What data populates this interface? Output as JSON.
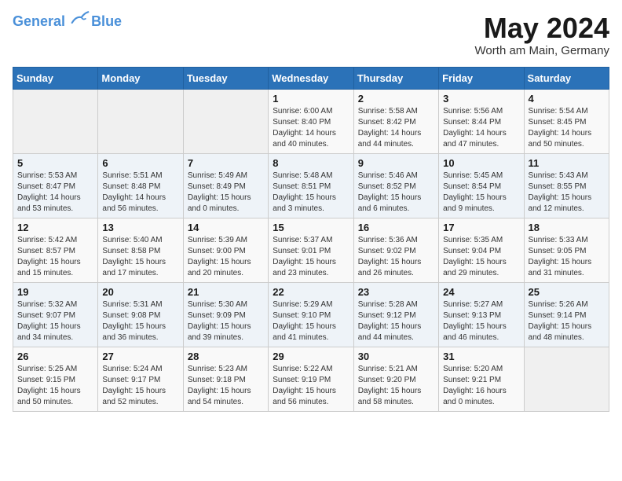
{
  "header": {
    "logo_line1": "General",
    "logo_line2": "Blue",
    "month": "May 2024",
    "location": "Worth am Main, Germany"
  },
  "weekdays": [
    "Sunday",
    "Monday",
    "Tuesday",
    "Wednesday",
    "Thursday",
    "Friday",
    "Saturday"
  ],
  "weeks": [
    [
      {
        "day": "",
        "sunrise": "",
        "sunset": "",
        "daylight": ""
      },
      {
        "day": "",
        "sunrise": "",
        "sunset": "",
        "daylight": ""
      },
      {
        "day": "",
        "sunrise": "",
        "sunset": "",
        "daylight": ""
      },
      {
        "day": "1",
        "sunrise": "Sunrise: 6:00 AM",
        "sunset": "Sunset: 8:40 PM",
        "daylight": "Daylight: 14 hours and 40 minutes."
      },
      {
        "day": "2",
        "sunrise": "Sunrise: 5:58 AM",
        "sunset": "Sunset: 8:42 PM",
        "daylight": "Daylight: 14 hours and 44 minutes."
      },
      {
        "day": "3",
        "sunrise": "Sunrise: 5:56 AM",
        "sunset": "Sunset: 8:44 PM",
        "daylight": "Daylight: 14 hours and 47 minutes."
      },
      {
        "day": "4",
        "sunrise": "Sunrise: 5:54 AM",
        "sunset": "Sunset: 8:45 PM",
        "daylight": "Daylight: 14 hours and 50 minutes."
      }
    ],
    [
      {
        "day": "5",
        "sunrise": "Sunrise: 5:53 AM",
        "sunset": "Sunset: 8:47 PM",
        "daylight": "Daylight: 14 hours and 53 minutes."
      },
      {
        "day": "6",
        "sunrise": "Sunrise: 5:51 AM",
        "sunset": "Sunset: 8:48 PM",
        "daylight": "Daylight: 14 hours and 56 minutes."
      },
      {
        "day": "7",
        "sunrise": "Sunrise: 5:49 AM",
        "sunset": "Sunset: 8:49 PM",
        "daylight": "Daylight: 15 hours and 0 minutes."
      },
      {
        "day": "8",
        "sunrise": "Sunrise: 5:48 AM",
        "sunset": "Sunset: 8:51 PM",
        "daylight": "Daylight: 15 hours and 3 minutes."
      },
      {
        "day": "9",
        "sunrise": "Sunrise: 5:46 AM",
        "sunset": "Sunset: 8:52 PM",
        "daylight": "Daylight: 15 hours and 6 minutes."
      },
      {
        "day": "10",
        "sunrise": "Sunrise: 5:45 AM",
        "sunset": "Sunset: 8:54 PM",
        "daylight": "Daylight: 15 hours and 9 minutes."
      },
      {
        "day": "11",
        "sunrise": "Sunrise: 5:43 AM",
        "sunset": "Sunset: 8:55 PM",
        "daylight": "Daylight: 15 hours and 12 minutes."
      }
    ],
    [
      {
        "day": "12",
        "sunrise": "Sunrise: 5:42 AM",
        "sunset": "Sunset: 8:57 PM",
        "daylight": "Daylight: 15 hours and 15 minutes."
      },
      {
        "day": "13",
        "sunrise": "Sunrise: 5:40 AM",
        "sunset": "Sunset: 8:58 PM",
        "daylight": "Daylight: 15 hours and 17 minutes."
      },
      {
        "day": "14",
        "sunrise": "Sunrise: 5:39 AM",
        "sunset": "Sunset: 9:00 PM",
        "daylight": "Daylight: 15 hours and 20 minutes."
      },
      {
        "day": "15",
        "sunrise": "Sunrise: 5:37 AM",
        "sunset": "Sunset: 9:01 PM",
        "daylight": "Daylight: 15 hours and 23 minutes."
      },
      {
        "day": "16",
        "sunrise": "Sunrise: 5:36 AM",
        "sunset": "Sunset: 9:02 PM",
        "daylight": "Daylight: 15 hours and 26 minutes."
      },
      {
        "day": "17",
        "sunrise": "Sunrise: 5:35 AM",
        "sunset": "Sunset: 9:04 PM",
        "daylight": "Daylight: 15 hours and 29 minutes."
      },
      {
        "day": "18",
        "sunrise": "Sunrise: 5:33 AM",
        "sunset": "Sunset: 9:05 PM",
        "daylight": "Daylight: 15 hours and 31 minutes."
      }
    ],
    [
      {
        "day": "19",
        "sunrise": "Sunrise: 5:32 AM",
        "sunset": "Sunset: 9:07 PM",
        "daylight": "Daylight: 15 hours and 34 minutes."
      },
      {
        "day": "20",
        "sunrise": "Sunrise: 5:31 AM",
        "sunset": "Sunset: 9:08 PM",
        "daylight": "Daylight: 15 hours and 36 minutes."
      },
      {
        "day": "21",
        "sunrise": "Sunrise: 5:30 AM",
        "sunset": "Sunset: 9:09 PM",
        "daylight": "Daylight: 15 hours and 39 minutes."
      },
      {
        "day": "22",
        "sunrise": "Sunrise: 5:29 AM",
        "sunset": "Sunset: 9:10 PM",
        "daylight": "Daylight: 15 hours and 41 minutes."
      },
      {
        "day": "23",
        "sunrise": "Sunrise: 5:28 AM",
        "sunset": "Sunset: 9:12 PM",
        "daylight": "Daylight: 15 hours and 44 minutes."
      },
      {
        "day": "24",
        "sunrise": "Sunrise: 5:27 AM",
        "sunset": "Sunset: 9:13 PM",
        "daylight": "Daylight: 15 hours and 46 minutes."
      },
      {
        "day": "25",
        "sunrise": "Sunrise: 5:26 AM",
        "sunset": "Sunset: 9:14 PM",
        "daylight": "Daylight: 15 hours and 48 minutes."
      }
    ],
    [
      {
        "day": "26",
        "sunrise": "Sunrise: 5:25 AM",
        "sunset": "Sunset: 9:15 PM",
        "daylight": "Daylight: 15 hours and 50 minutes."
      },
      {
        "day": "27",
        "sunrise": "Sunrise: 5:24 AM",
        "sunset": "Sunset: 9:17 PM",
        "daylight": "Daylight: 15 hours and 52 minutes."
      },
      {
        "day": "28",
        "sunrise": "Sunrise: 5:23 AM",
        "sunset": "Sunset: 9:18 PM",
        "daylight": "Daylight: 15 hours and 54 minutes."
      },
      {
        "day": "29",
        "sunrise": "Sunrise: 5:22 AM",
        "sunset": "Sunset: 9:19 PM",
        "daylight": "Daylight: 15 hours and 56 minutes."
      },
      {
        "day": "30",
        "sunrise": "Sunrise: 5:21 AM",
        "sunset": "Sunset: 9:20 PM",
        "daylight": "Daylight: 15 hours and 58 minutes."
      },
      {
        "day": "31",
        "sunrise": "Sunrise: 5:20 AM",
        "sunset": "Sunset: 9:21 PM",
        "daylight": "Daylight: 16 hours and 0 minutes."
      },
      {
        "day": "",
        "sunrise": "",
        "sunset": "",
        "daylight": ""
      }
    ]
  ]
}
